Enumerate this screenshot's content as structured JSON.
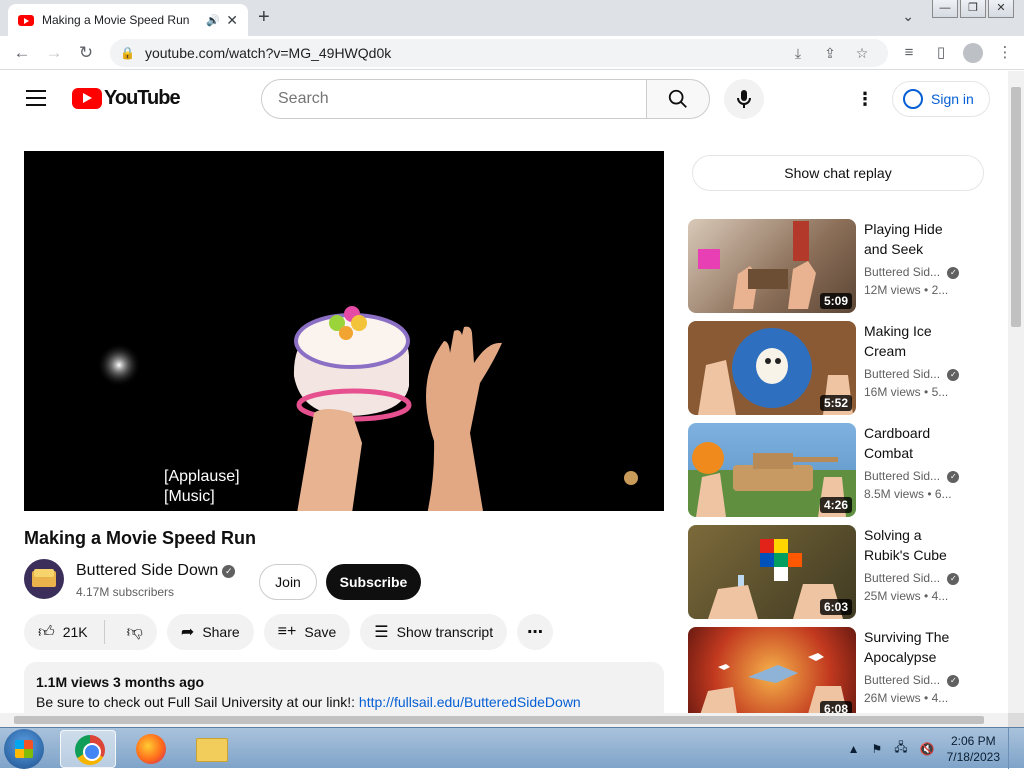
{
  "browser": {
    "tab_title": "Making a Movie Speed Run",
    "new_tab": "+",
    "url": "youtube.com/watch?v=MG_49HWQd0k",
    "window_controls": [
      "—",
      "❐",
      "✕"
    ]
  },
  "youtube": {
    "logo_text": "YouTube",
    "search_placeholder": "Search",
    "sign_in": "Sign in"
  },
  "video": {
    "captions": [
      "[Applause]",
      "[Music]"
    ],
    "title": "Making a Movie Speed Run",
    "channel": "Buttered Side Down",
    "subscribers": "4.17M subscribers",
    "join": "Join",
    "subscribe": "Subscribe",
    "likes": "21K",
    "share": "Share",
    "save": "Save",
    "transcript": "Show transcript",
    "views_age": "1.1M views  3 months ago",
    "description_prefix": "Be sure to check out Full Sail University at our link!: ",
    "description_link": "http://fullsail.edu/ButteredSideDown"
  },
  "sidebar": {
    "chat_replay": "Show chat replay",
    "recommendations": [
      {
        "title": "Playing Hide and Seek",
        "channel": "Buttered Sid...",
        "views": "12M views",
        "age": "• 2...",
        "duration": "5:09"
      },
      {
        "title": "Making Ice Cream",
        "channel": "Buttered Sid...",
        "views": "16M views",
        "age": "• 5...",
        "duration": "5:52"
      },
      {
        "title": "Cardboard Combat",
        "channel": "Buttered Sid...",
        "views": "8.5M views",
        "age": "• 6...",
        "duration": "4:26"
      },
      {
        "title": "Solving a Rubik's Cube",
        "channel": "Buttered Sid...",
        "views": "25M views",
        "age": "• 4...",
        "duration": "6:03"
      },
      {
        "title": "Surviving The Apocalypse",
        "channel": "Buttered Sid...",
        "views": "26M views",
        "age": "• 4...",
        "duration": "6:08"
      }
    ]
  },
  "taskbar": {
    "time": "2:06 PM",
    "date": "7/18/2023"
  }
}
